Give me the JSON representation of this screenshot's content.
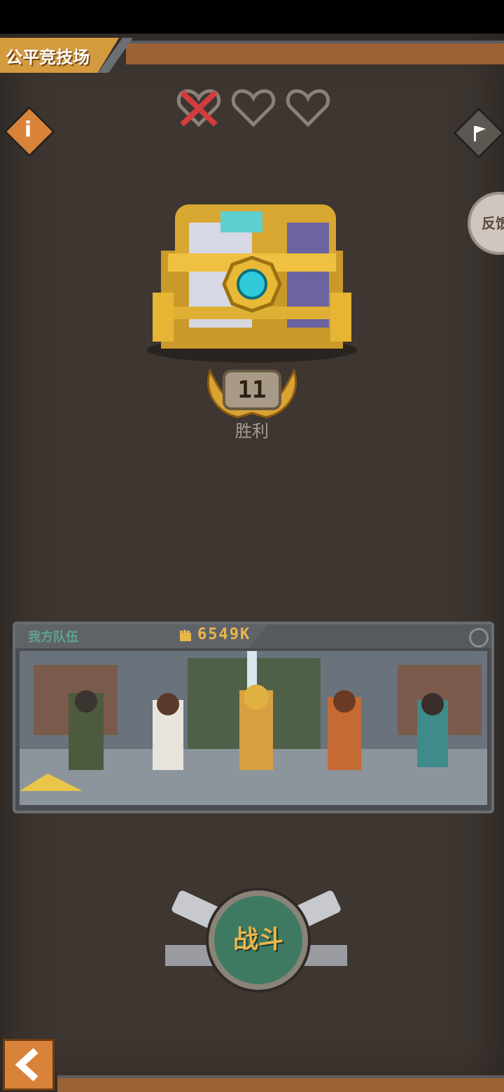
{
  "header": {
    "title": "公平竞技场"
  },
  "lives": {
    "total": 3,
    "lost": 1
  },
  "side_buttons": {
    "feedback_label": "反馈"
  },
  "reward": {
    "wins": "11",
    "wins_label": "胜利"
  },
  "team": {
    "label": "我方队伍",
    "power": "6549K"
  },
  "actions": {
    "fight_label": "战斗"
  },
  "icons": {
    "info": "info-icon",
    "flag": "flag-icon",
    "heart": "heart-icon",
    "chest": "treasure-chest-icon",
    "power": "fist-icon",
    "back": "back-arrow-icon"
  },
  "colors": {
    "background": "#3d3631",
    "accent_orange": "#d9833a",
    "gold": "#e9b64a",
    "team_label": "#5fa38e",
    "fight_button": "#3e7a62",
    "lost_heart": "#d23c3c"
  }
}
